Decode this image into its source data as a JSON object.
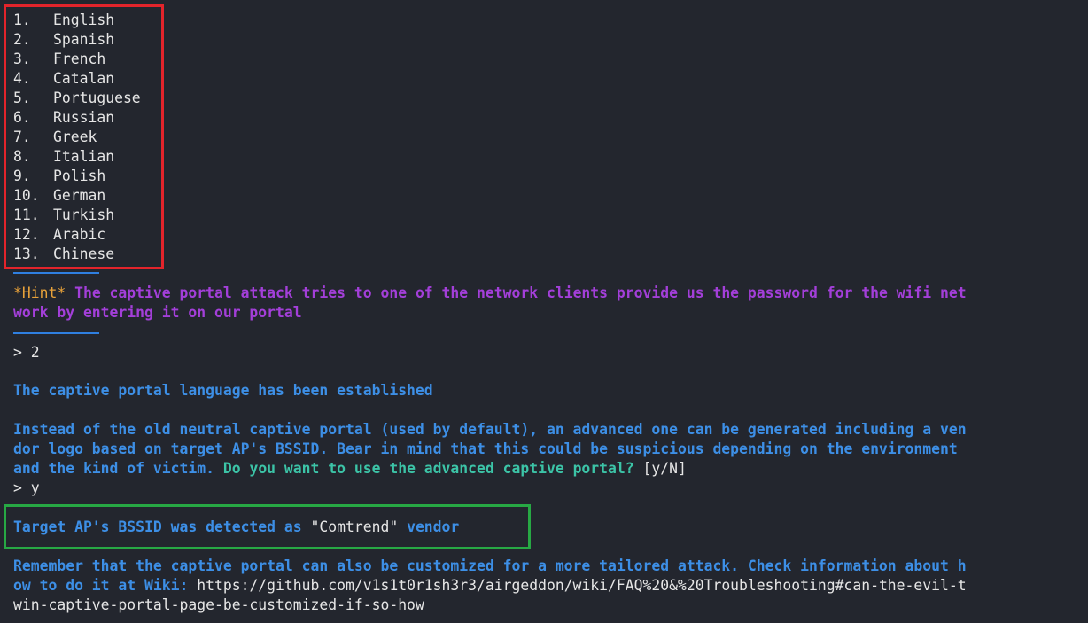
{
  "languages": [
    {
      "num": "1.",
      "name": "English"
    },
    {
      "num": "2.",
      "name": "Spanish"
    },
    {
      "num": "3.",
      "name": "French"
    },
    {
      "num": "4.",
      "name": "Catalan"
    },
    {
      "num": "5.",
      "name": "Portuguese"
    },
    {
      "num": "6.",
      "name": "Russian"
    },
    {
      "num": "7.",
      "name": "Greek"
    },
    {
      "num": "8.",
      "name": "Italian"
    },
    {
      "num": "9.",
      "name": "Polish"
    },
    {
      "num": "10.",
      "name": "German"
    },
    {
      "num": "11.",
      "name": "Turkish"
    },
    {
      "num": "12.",
      "name": "Arabic"
    },
    {
      "num": "13.",
      "name": "Chinese"
    }
  ],
  "hint": {
    "tag": "*Hint*",
    "line1": " The captive portal attack tries to one of the network clients provide us the password for the wifi net",
    "line2": "work by entering it on our portal"
  },
  "prompt1": "> 2",
  "established": "The captive portal language has been established",
  "advanced": {
    "line1": "Instead of the old neutral captive portal (used by default), an advanced one can be generated including a ven",
    "line2": "dor logo based on target AP's BSSID. Bear in mind that this could be suspicious depending on the environment",
    "line3a": "and the kind of victim. ",
    "line3b": "Do you want to use the advanced captive portal?",
    "line3c": " [y/N]"
  },
  "prompt2": "> y",
  "detected": {
    "pre": "Target AP's BSSID was detected as ",
    "vendor": "\"Comtrend\"",
    "post": " vendor"
  },
  "remember": {
    "line1": "Remember that the captive portal can also be customized for a more tailored attack. Check information about h",
    "line2a": "ow to do it at Wiki: ",
    "line2b": "https://github.com/v1s1t0r1sh3r3/airgeddon/wiki/FAQ%20&%20Troubleshooting#can-the-evil-t",
    "line3": "win-captive-portal-page-be-customized-if-so-how"
  },
  "colors": {
    "background": "#23262e",
    "blue": "#3d8fe6",
    "purple": "#a33fd9",
    "orange": "#e8a23a",
    "teal": "#3cc4a7",
    "red_box": "#e3242b",
    "green_box": "#27a844"
  }
}
